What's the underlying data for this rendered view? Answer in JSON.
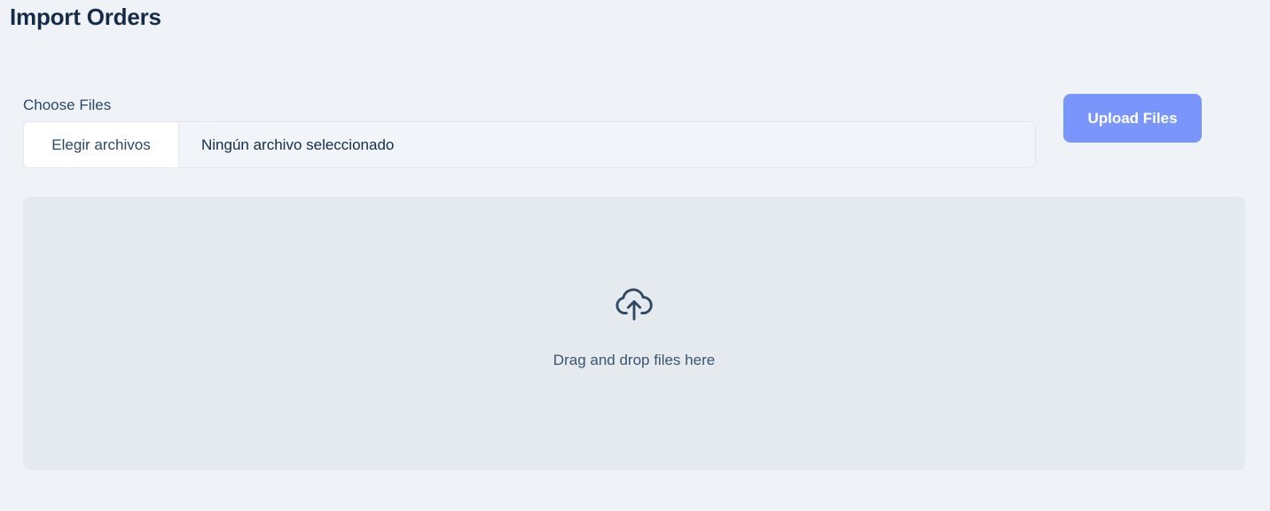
{
  "page": {
    "title": "Import Orders"
  },
  "file_picker": {
    "label": "Choose Files",
    "button_label": "Elegir archivos",
    "status_text": "Ningún archivo seleccionado"
  },
  "upload": {
    "button_label": "Upload Files",
    "color": "#7a95fb"
  },
  "dropzone": {
    "icon": "cloud-upload-icon",
    "text": "Drag and drop files here"
  }
}
